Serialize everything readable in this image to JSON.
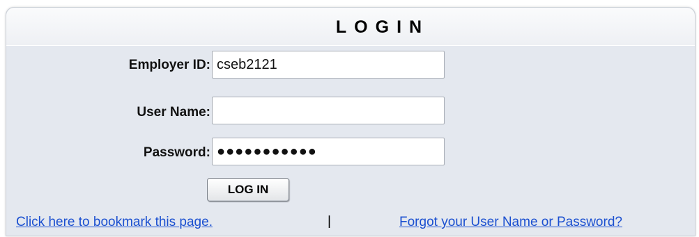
{
  "header": {
    "title": "LOGIN"
  },
  "form": {
    "employer_id": {
      "label": "Employer ID:",
      "value": "cseb2121"
    },
    "user_name": {
      "label": "User Name:",
      "value": ""
    },
    "password": {
      "label": "Password:",
      "masked_value": "●●●●●●●●●●●"
    },
    "login_button_label": "LOG IN"
  },
  "footer": {
    "bookmark_link": "Click here to bookmark this page.",
    "separator": "|",
    "forgot_link": "Forgot your User Name or Password?"
  },
  "colors": {
    "panel_bg": "#e4e8ef",
    "link": "#1a4fd0"
  }
}
